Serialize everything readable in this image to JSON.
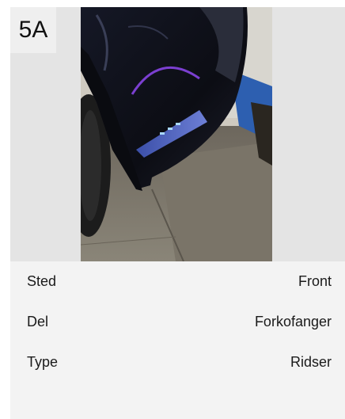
{
  "photo": {
    "badge": "5A"
  },
  "details": {
    "rows": [
      {
        "label": "Sted",
        "value": "Front"
      },
      {
        "label": "Del",
        "value": "Forkofanger"
      },
      {
        "label": "Type",
        "value": "Ridser"
      }
    ]
  }
}
